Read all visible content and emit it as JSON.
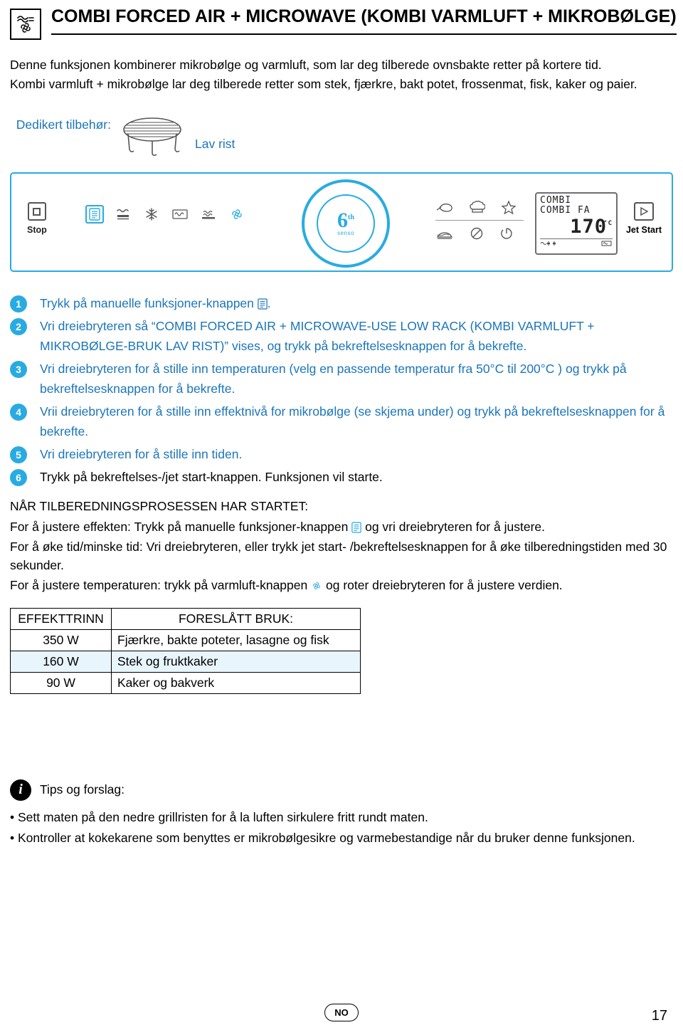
{
  "header": {
    "icon": "fan-heat-icon",
    "title": "COMBI FORCED AIR + MICROWAVE (KOMBI VARMLUFT + MIKROBØLGE)"
  },
  "intro": {
    "line1": "Denne funksjonen kombinerer mikrobølge og varmluft, som lar deg tilberede ovnsbakte retter på kortere tid.",
    "line2": "Kombi varmluft + mikrobølge lar deg tilberede retter som stek, fjærkre, bakt potet, frossenmat, fisk, kaker og paier."
  },
  "accessory": {
    "label": "Dedikert tilbehør:",
    "name": "Lav rist"
  },
  "panel": {
    "stop_label": "Stop",
    "jet_start_label": "Jet Start",
    "dial_brand": "6th senso",
    "dial_number": "6",
    "dial_sup": "th",
    "dial_sub": "senso",
    "display": {
      "line1": "COMBI",
      "line2": "COMBI FA",
      "value": "170",
      "unit": "°C"
    },
    "icons_left": [
      "menu-icon",
      "grill-icon",
      "defrost-icon",
      "microwave-icon",
      "steam-icon",
      "fan-icon"
    ],
    "icons_right_row1": [
      "meat-icon",
      "chef-hat-icon",
      "star-icon"
    ],
    "icons_right_row2": [
      "cake-icon",
      "no-entry-icon",
      "clock-icon"
    ]
  },
  "steps": [
    {
      "num": "1",
      "text": "Trykk på manuelle funksjoner-knappen ",
      "suffix": "."
    },
    {
      "num": "2",
      "text": "Vri dreiebryteren så “COMBI FORCED AIR + MICROWAVE-USE LOW RACK (KOMBI VARMLUFT + MIKROBØLGE-BRUK LAV RIST)” vises, og trykk på bekreftelsesknappen for å bekrefte."
    },
    {
      "num": "3",
      "text": "Vri dreiebryteren for å stille inn temperaturen (velg en passende temperatur fra 50°C til 200°C ) og trykk på bekreftelsesknappen for å bekrefte."
    },
    {
      "num": "4",
      "text": "Vrii dreiebryteren for å stille inn effektnivå for mikrobølge (se skjema under) og trykk på bekreftelsesknappen for å bekrefte."
    },
    {
      "num": "5",
      "text": "Vri dreiebryteren for å stille inn tiden."
    },
    {
      "num": "6",
      "text": "Trykk på bekreftelses-/jet start-knappen. Funksjonen vil starte."
    }
  ],
  "after": {
    "heading": "NÅR TILBEREDNINGSPROSESSEN HAR STARTET:",
    "p1_a": "For å justere effekten: Trykk på manuelle funksjoner-knappen",
    "p1_b": "og vri dreiebryteren for å justere.",
    "p2": "For å øke tid/minske tid: Vri dreiebryteren, eller trykk jet start- /bekreftelsesknappen for å øke tilberedningstiden med 30 sekunder.",
    "p3_a": "For å justere temperaturen: trykk på varmluft-knappen",
    "p3_b": "og roter dreiebryteren for å justere verdien."
  },
  "table": {
    "headers": [
      "EFFEKTTRINN",
      "FORESLÅTT BRUK:"
    ],
    "rows": [
      {
        "power": "350 W",
        "use": "Fjærkre, bakte poteter, lasagne og fisk"
      },
      {
        "power": "160 W",
        "use": "Stek og fruktkaker"
      },
      {
        "power": "90 W",
        "use": "Kaker og bakverk"
      }
    ]
  },
  "tips": {
    "title": "Tips og forslag:",
    "items": [
      "• Sett maten på den nedre grillristen for å la luften sirkulere fritt rundt maten.",
      "• Kontroller at kokekarene som benyttes er mikrobølgesikre og varmebestandige når du bruker denne funksjonen."
    ]
  },
  "footer": {
    "language": "NO",
    "page_number": "17"
  },
  "colors": {
    "accent": "#29abe2",
    "text_blue": "#1b75bb",
    "table_alt": "#e8f5fc"
  }
}
